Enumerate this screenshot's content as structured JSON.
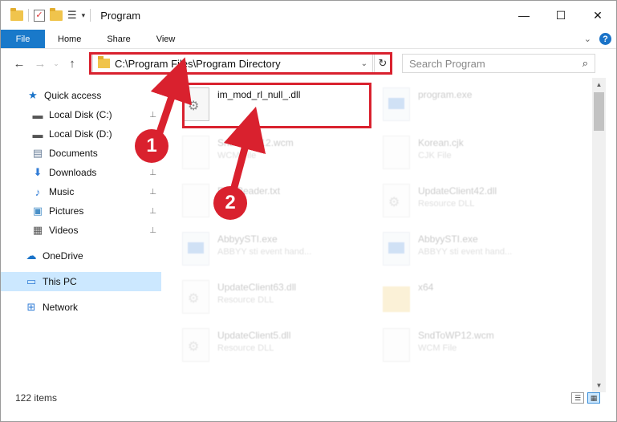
{
  "window": {
    "title": "Program",
    "minimize": "—",
    "maximize": "☐",
    "close": "✕"
  },
  "ribbon": {
    "file_tab": "File",
    "tabs": [
      "Home",
      "Share",
      "View"
    ],
    "help": "?"
  },
  "navbar": {
    "back": "←",
    "forward": "→",
    "recent": "⌄",
    "up": "↑",
    "address": "C:\\Program Files\\Program Directory",
    "refresh": "↻",
    "search_placeholder": "Search Program",
    "search_icon": "⌕"
  },
  "sidebar": {
    "items": [
      {
        "label": "Quick access",
        "icon": "star-icon",
        "glyph": "★",
        "color": "#1a73c8",
        "pinned": false
      },
      {
        "label": "Local Disk (C:)",
        "icon": "drive-icon",
        "glyph": "▬",
        "color": "#555555",
        "pinned": true
      },
      {
        "label": "Local Disk (D:)",
        "icon": "drive-icon",
        "glyph": "▬",
        "color": "#555555",
        "pinned": true
      },
      {
        "label": "Documents",
        "icon": "documents-icon",
        "glyph": "▤",
        "color": "#6a7f99",
        "pinned": true
      },
      {
        "label": "Downloads",
        "icon": "download-icon",
        "glyph": "⬇",
        "color": "#2f7bd6",
        "pinned": true
      },
      {
        "label": "Music",
        "icon": "music-icon",
        "glyph": "♪",
        "color": "#2f7bd6",
        "pinned": true
      },
      {
        "label": "Pictures",
        "icon": "pictures-icon",
        "glyph": "▣",
        "color": "#4a90c8",
        "pinned": true
      },
      {
        "label": "Videos",
        "icon": "videos-icon",
        "glyph": "▦",
        "color": "#555555",
        "pinned": true
      },
      {
        "label": "OneDrive",
        "icon": "cloud-icon",
        "glyph": "☁",
        "color": "#1a73c8",
        "pinned": false
      },
      {
        "label": "This PC",
        "icon": "computer-icon",
        "glyph": "▭",
        "color": "#2f7bd6",
        "pinned": false
      },
      {
        "label": "Network",
        "icon": "network-icon",
        "glyph": "⊞",
        "color": "#2f7bd6",
        "pinned": false
      }
    ],
    "pin_glyph": "📌"
  },
  "files": [
    {
      "name": "im_mod_rl_null_.dll",
      "type": "",
      "icon": "dll",
      "faded": false
    },
    {
      "name": "program.exe",
      "type": "",
      "icon": "exe",
      "faded": true
    },
    {
      "name": "SndToWP12.wcm",
      "type": "WCM File",
      "icon": "blank",
      "faded": true
    },
    {
      "name": "Korean.cjk",
      "type": "CJK File",
      "icon": "blank",
      "faded": true
    },
    {
      "name": "FineReader.txt",
      "type": "",
      "icon": "blank",
      "faded": true
    },
    {
      "name": "UpdateClient42.dll",
      "type": "Resource DLL",
      "icon": "dll",
      "faded": true
    },
    {
      "name": "AbbyySTI.exe",
      "type": "ABBYY sti event hand...",
      "icon": "exe",
      "faded": true
    },
    {
      "name": "AbbyySTI.exe",
      "type": "ABBYY sti event hand...",
      "icon": "exe",
      "faded": true
    },
    {
      "name": "UpdateClient63.dll",
      "type": "Resource DLL",
      "icon": "dll",
      "faded": true
    },
    {
      "name": "x64",
      "type": "",
      "icon": "folder",
      "faded": true
    },
    {
      "name": "UpdateClient5.dll",
      "type": "Resource DLL",
      "icon": "dll",
      "faded": true
    },
    {
      "name": "SndToWP12.wcm",
      "type": "WCM File",
      "icon": "blank",
      "faded": true
    }
  ],
  "status": {
    "item_count": "122 items"
  },
  "annotations": {
    "step1": "1",
    "step2": "2",
    "accent": "#d9212e"
  }
}
